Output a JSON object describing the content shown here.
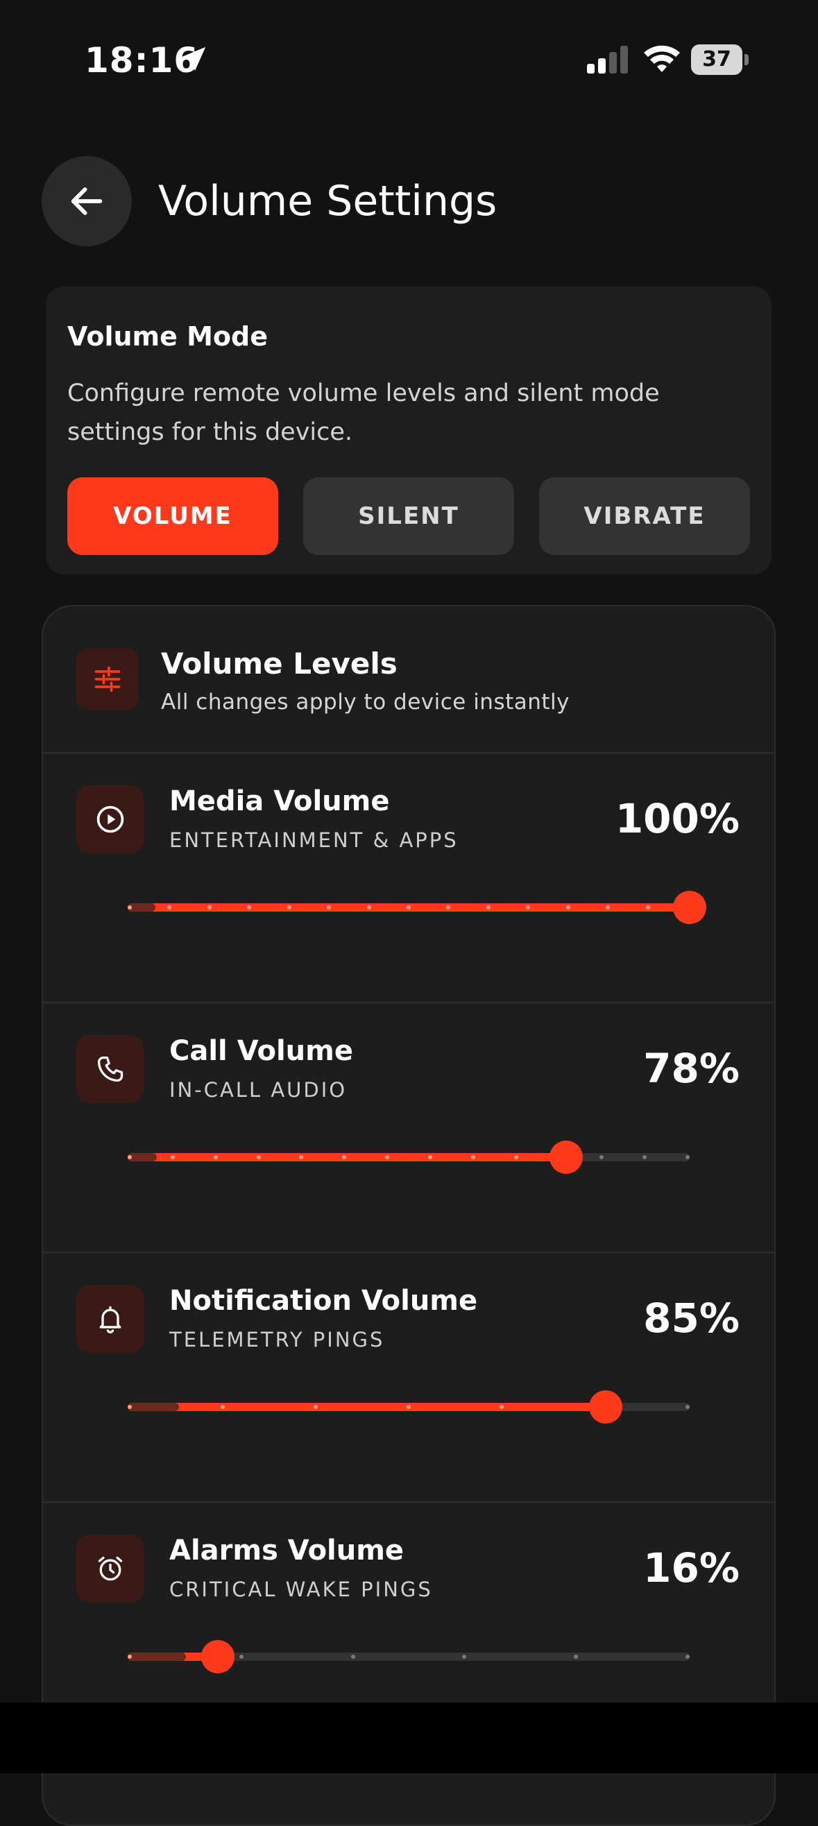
{
  "status_bar": {
    "time": "18:16",
    "battery": "37"
  },
  "header": {
    "title": "Volume Settings"
  },
  "volume_mode": {
    "title": "Volume Mode",
    "description": "Configure remote volume levels and silent mode settings for this device.",
    "buttons": [
      {
        "label": "VOLUME",
        "active": true
      },
      {
        "label": "SILENT",
        "active": false
      },
      {
        "label": "VIBRATE",
        "active": false
      }
    ]
  },
  "volume_levels": {
    "title": "Volume Levels",
    "subtitle": "All changes apply to device instantly",
    "rows": [
      {
        "title": "Media Volume",
        "subtitle": "ENTERTAINMENT & APPS",
        "percent_label": "100%",
        "level": 1.0,
        "steps": 15,
        "icon": "play-circle-icon"
      },
      {
        "title": "Call Volume",
        "subtitle": "IN-CALL AUDIO",
        "percent_label": "78%",
        "level": 0.78,
        "steps": 14,
        "icon": "phone-icon"
      },
      {
        "title": "Notification Volume",
        "subtitle": "TELEMETRY PINGS",
        "percent_label": "85%",
        "level": 0.85,
        "steps": 7,
        "icon": "bell-icon"
      },
      {
        "title": "Alarms Volume",
        "subtitle": "CRITICAL WAKE PINGS",
        "percent_label": "16%",
        "level": 0.16,
        "steps": 6,
        "icon": "alarm-clock-icon"
      }
    ]
  },
  "colors": {
    "accent": "#ff3a1c",
    "background": "#121212",
    "card": "#1e1e1e",
    "icon_bg": "#3a1a16"
  }
}
